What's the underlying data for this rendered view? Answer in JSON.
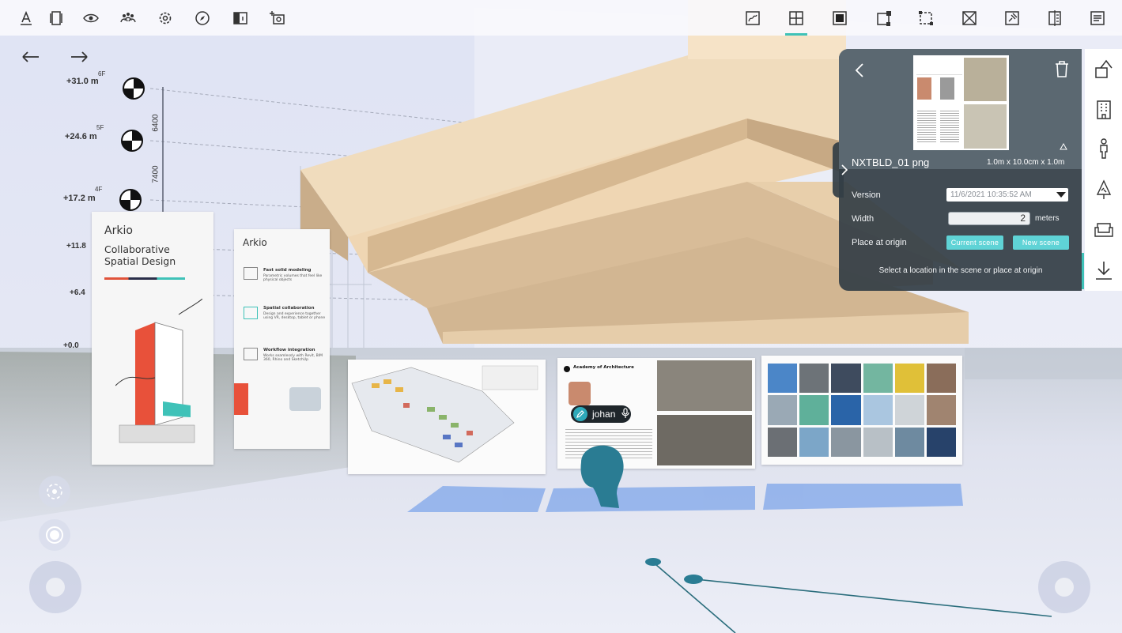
{
  "toolbar": {
    "left_icons": [
      "text-style-icon",
      "layers-icon",
      "eye-icon",
      "people-icon",
      "gear-icon",
      "compass-icon",
      "view-split-icon",
      "screenshot-icon"
    ],
    "right_icons": [
      "sketch-icon",
      "add-grid-icon",
      "solid-icon",
      "node-edit-icon",
      "select-area-icon",
      "delete-box-icon",
      "pin-icon",
      "section-icon",
      "document-icon"
    ],
    "active_right_index": 1
  },
  "history": {
    "undo": "undo-icon",
    "redo": "redo-icon"
  },
  "levels": [
    {
      "name": "6F",
      "height": "+31.0 m"
    },
    {
      "name": "5F",
      "height": "+24.6 m"
    },
    {
      "name": "4F",
      "height": "+17.2 m"
    },
    {
      "name": "",
      "height": "+11.8"
    },
    {
      "name": "",
      "height": "+6.4"
    },
    {
      "name": "",
      "height": "+0.0"
    }
  ],
  "dimensions": [
    "6400",
    "7400"
  ],
  "boards": {
    "brand": "Arkio",
    "brand_short": "rkio",
    "headline": "Collaborative Spatial Design",
    "features": [
      {
        "title": "Fast solid modeling",
        "text": "Parametric volumes that feel like physical objects"
      },
      {
        "title": "Spatial collaboration",
        "text": "Design and experience together using VR, desktop, tablet or phone"
      },
      {
        "title": "Workflow integration",
        "text": "Works seamlessly with Revit, BIM 360, Rhino and SketchUp"
      }
    ],
    "academy_title": "Academy of Architecture"
  },
  "user": {
    "name": "johan",
    "mic": "mic-icon"
  },
  "panel": {
    "file_name": "NXTBLD_01 png",
    "file_size": "1.0m x 10.0cm x 1.0m",
    "version_label": "Version",
    "version_value": "11/6/2021 10:35:52 AM",
    "width_label": "Width",
    "width_value": "2",
    "width_unit": "meters",
    "origin_label": "Place at origin",
    "current_scene": "Current scene",
    "new_scene": "New scene",
    "hint": "Select a location in the scene or place at origin"
  },
  "right_toolbar": [
    "shapes-icon",
    "building-icon",
    "person-icon",
    "tree-icon",
    "sofa-icon",
    "download-icon"
  ],
  "right_toolbar_active_index": 5,
  "colors": {
    "accent": "#3fc2b8",
    "panel": "#343e46",
    "teal_button": "#5fd3d6",
    "avatar": "#2a7c93",
    "volume": "#e9d0ad"
  }
}
